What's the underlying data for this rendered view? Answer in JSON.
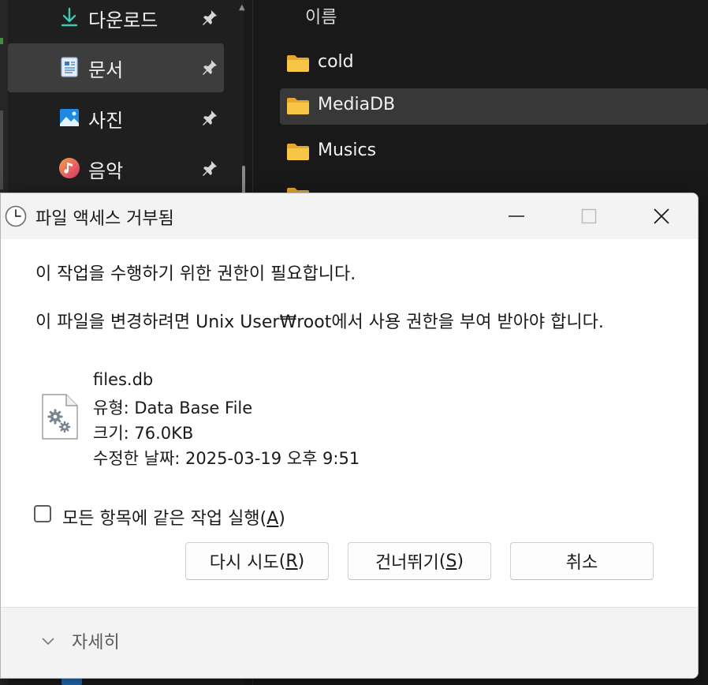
{
  "explorer": {
    "nav_items": [
      {
        "label": "다운로드",
        "icon": "download-icon",
        "selected": false
      },
      {
        "label": "문서",
        "icon": "documents-icon",
        "selected": true
      },
      {
        "label": "사진",
        "icon": "pictures-icon",
        "selected": false
      },
      {
        "label": "음악",
        "icon": "music-icon",
        "selected": false
      }
    ],
    "column_header": "이름",
    "files": [
      {
        "name": "cold",
        "selected": false
      },
      {
        "name": "MediaDB",
        "selected": true
      },
      {
        "name": "Musics",
        "selected": false
      }
    ]
  },
  "dialog": {
    "title": "파일 액세스 거부됨",
    "message_primary": "이 작업을 수행하기 위한 권한이 필요합니다.",
    "message_secondary": "이 파일을 변경하려면 Unix User₩root에서 사용 권한을 부여 받아야 합니다.",
    "file": {
      "name": "files.db",
      "type": "유형: Data Base File",
      "size": "크기: 76.0KB",
      "modified": "수정한 날짜: 2025-03-19 오후 9:51"
    },
    "apply_all": {
      "label": "모든 항목에 같은 작업 실행",
      "mnemonic": "A",
      "checked": false
    },
    "buttons": {
      "retry": {
        "label": "다시 시도",
        "mnemonic": "R"
      },
      "skip": {
        "label": "건너뛰기",
        "mnemonic": "S"
      },
      "cancel": {
        "label": "취소"
      }
    },
    "details_label": "자세히"
  },
  "colors": {
    "accent_blue": "#2a7fd4",
    "folder_yellow": "#f8c646",
    "dialog_bg": "#ffffff",
    "explorer_bg": "#191919"
  }
}
